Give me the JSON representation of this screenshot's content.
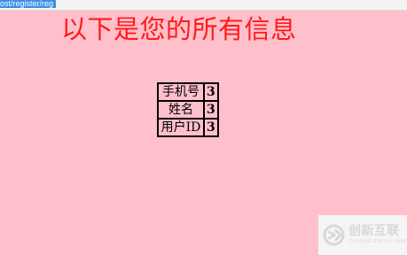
{
  "browser": {
    "url_fragment": "ost/register/reg"
  },
  "page": {
    "title": "以下是您的所有信息"
  },
  "info_table": {
    "rows": [
      {
        "label": "手机号",
        "value": "3"
      },
      {
        "label": "姓名",
        "value": "3"
      },
      {
        "label": "用户ID",
        "value": "3"
      }
    ]
  },
  "watermark": {
    "name": "创新互联",
    "subtitle": "CHUANG XIN HU LIAN"
  },
  "colors": {
    "background": "#ffc0cb",
    "title": "#ff1a1a",
    "table_border": "#000000",
    "watermark": "#d8d8d8",
    "url_highlight": "#3d8ee8"
  }
}
